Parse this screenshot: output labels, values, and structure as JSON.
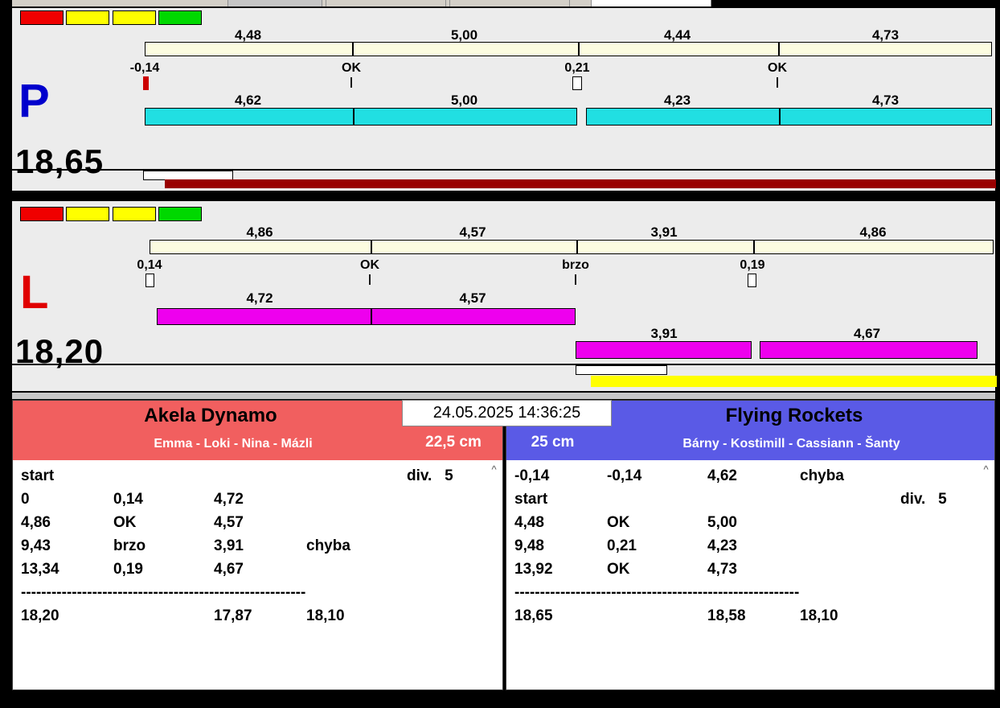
{
  "timestamp": "24.05.2025 14:36:25",
  "ui": {
    "scroll_up_glyph": "^"
  },
  "colors": {
    "panel_bg": "#ececec",
    "ideal_bar": "#fcfce0",
    "right_run_bar_cyan": "#21dfe2",
    "left_run_bar_magenta": "#ee00ee",
    "right_progress_dark_red": "#990000",
    "left_progress_yellow": "#ffff00",
    "status_red": "#f00000",
    "status_yellow": "#ffff00",
    "status_green": "#00d800",
    "left_team_header": "#f15f5f",
    "right_team_header": "#5a5ae6",
    "letter_p_blue": "#0000cd",
    "letter_l_red": "#e00000"
  },
  "lane_p": {
    "letter": "P",
    "total": "18,65",
    "upper_values": [
      "4,48",
      "5,00",
      "4,44",
      "4,73"
    ],
    "markers": [
      "-0,14",
      "OK",
      "0,21",
      "OK"
    ],
    "lower_values": [
      "4,62",
      "5,00",
      "4,23",
      "4,73"
    ]
  },
  "lane_l": {
    "letter": "L",
    "total": "18,20",
    "upper_values": [
      "4,86",
      "4,57",
      "3,91",
      "4,86"
    ],
    "markers": [
      "0,14",
      "OK",
      "brzo",
      "0,19"
    ],
    "mid_values": [
      "4,72",
      "4,57"
    ],
    "lower_values": [
      "3,91",
      "4,67"
    ]
  },
  "teams": {
    "left": {
      "name": "Akela Dynamo",
      "members": "Emma - Loki - Nina - Mázli",
      "jump_height": "22,5 cm",
      "rows": [
        [
          "start",
          "",
          "",
          "",
          "div.   5"
        ],
        [
          "0",
          "0,14",
          "4,72",
          "",
          ""
        ],
        [
          "4,86",
          "OK",
          "4,57",
          "",
          ""
        ],
        [
          "9,43",
          "brzo",
          "3,91",
          "chyba",
          ""
        ],
        [
          "13,34",
          "0,19",
          "4,67",
          "",
          ""
        ],
        [
          "--------------------------------------------------------",
          "",
          "",
          "",
          ""
        ],
        [
          "18,20",
          "",
          "17,87",
          "18,10",
          ""
        ]
      ]
    },
    "right": {
      "name": "Flying Rockets",
      "members": "Bárny - Kostimill - Cassiann - Šanty",
      "jump_height": "25 cm",
      "rows": [
        [
          "-0,14",
          "-0,14",
          "4,62",
          "chyba",
          ""
        ],
        [
          "start",
          "",
          "",
          "",
          "div.   5"
        ],
        [
          "4,48",
          "OK",
          "5,00",
          "",
          ""
        ],
        [
          "9,48",
          "0,21",
          "4,23",
          "",
          ""
        ],
        [
          "13,92",
          "OK",
          "4,73",
          "",
          ""
        ],
        [
          "--------------------------------------------------------",
          "",
          "",
          "",
          ""
        ],
        [
          "18,65",
          "",
          "18,58",
          "18,10",
          ""
        ]
      ]
    }
  }
}
